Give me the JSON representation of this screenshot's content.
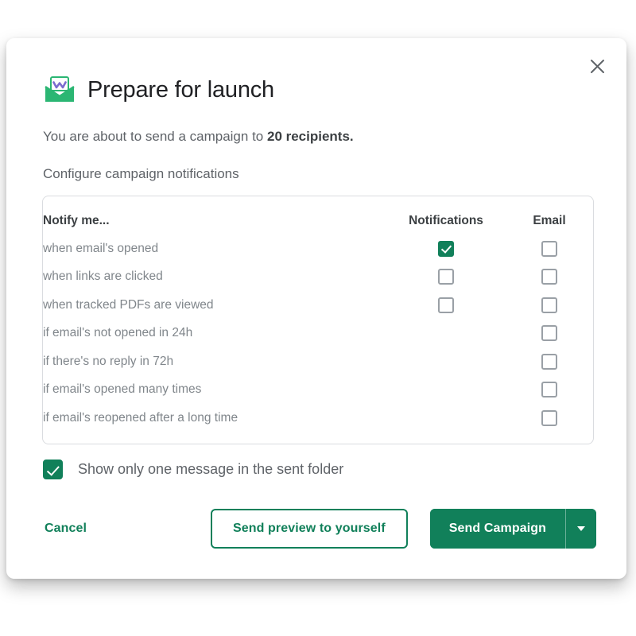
{
  "dialog": {
    "title": "Prepare for launch",
    "brand_icon": "open-envelope-icon",
    "close_icon": "close-icon",
    "subtitle_prefix": "You are about to send a campaign to ",
    "subtitle_strong": "20 recipients.",
    "section_label": "Configure campaign notifications"
  },
  "table": {
    "headers": {
      "label": "Notify me...",
      "notifications": "Notifications",
      "email": "Email"
    },
    "rows": [
      {
        "label": "when email's opened",
        "notifications": "checked",
        "email": "unchecked"
      },
      {
        "label": "when links are clicked",
        "notifications": "unchecked",
        "email": "unchecked"
      },
      {
        "label": "when tracked PDFs are viewed",
        "notifications": "unchecked",
        "email": "unchecked"
      },
      {
        "label": "if email's not opened in 24h",
        "notifications": "none",
        "email": "unchecked"
      },
      {
        "label": "if there's no reply in 72h",
        "notifications": "none",
        "email": "unchecked"
      },
      {
        "label": "if email's opened many times",
        "notifications": "none",
        "email": "unchecked"
      },
      {
        "label": "if email's reopened after a long time",
        "notifications": "none",
        "email": "unchecked"
      }
    ]
  },
  "sent_folder": {
    "label": "Show only one message in the sent folder",
    "state": "checked"
  },
  "actions": {
    "cancel_label": "Cancel",
    "preview_label": "Send preview to yourself",
    "send_label": "Send Campaign",
    "caret_icon": "chevron-down-icon"
  },
  "colors": {
    "brand_green": "#11805a",
    "envelope_green": "#2bb673",
    "accent_purple": "#7c6ccf",
    "text_primary": "#202124",
    "text_secondary": "#5f6368",
    "text_muted": "#80868b",
    "border": "#dadce0"
  }
}
